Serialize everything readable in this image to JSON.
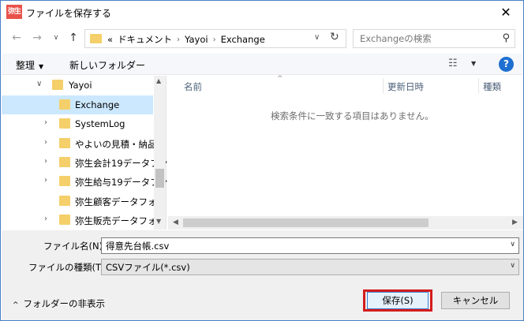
{
  "window": {
    "title": "ファイルを保存する",
    "app_icon_text": "弥生",
    "close_glyph": "✕"
  },
  "nav": {
    "back_glyph": "←",
    "forward_glyph": "→",
    "recent_glyph": "∨",
    "up_glyph": "↑",
    "address": {
      "overflow": "«",
      "crumbs": [
        "ドキュメント",
        "Yayoi",
        "Exchange"
      ],
      "separator": "›",
      "chevron": "∨",
      "refresh_glyph": "↻"
    },
    "search": {
      "placeholder": "Exchangeの検索",
      "icon_glyph": "⚲"
    }
  },
  "toolbar": {
    "organize_label": "整理",
    "organize_caret": "▼",
    "new_folder_label": "新しいフォルダー",
    "view_glyph": "☷",
    "view_caret": "▼",
    "help_glyph": "?"
  },
  "tree": {
    "items": [
      {
        "label": "Yayoi",
        "caret": "∨",
        "selected": false
      },
      {
        "label": "Exchange",
        "caret": "",
        "selected": true
      },
      {
        "label": "SystemLog",
        "caret": "›",
        "selected": false
      },
      {
        "label": "やよいの見積・納品・",
        "caret": "›",
        "selected": false
      },
      {
        "label": "弥生会計19データファ",
        "caret": "›",
        "selected": false
      },
      {
        "label": "弥生給与19データファ",
        "caret": "›",
        "selected": false
      },
      {
        "label": "弥生顧客データフォル",
        "caret": "",
        "selected": false
      },
      {
        "label": "弥生販売データフォル",
        "caret": "›",
        "selected": false
      }
    ],
    "scroll_up": "▲",
    "scroll_down": "▼"
  },
  "filelist": {
    "columns": [
      "名前",
      "更新日時",
      "種類"
    ],
    "sort_glyph": "^",
    "empty_message": "検索条件に一致する項目はありません。",
    "scroll_left": "◀",
    "scroll_right": "▶"
  },
  "form": {
    "filename_label": "ファイル名(N):",
    "filename_value": "得意先台帳.csv",
    "filetype_label": "ファイルの種類(T):",
    "filetype_value": "CSVファイル(*.csv)",
    "dropdown_glyph": "∨"
  },
  "footer": {
    "hide_folders_glyph": "^",
    "hide_folders_label": "フォルダーの非表示",
    "save_label": "保存(S)",
    "cancel_label": "キャンセル"
  }
}
